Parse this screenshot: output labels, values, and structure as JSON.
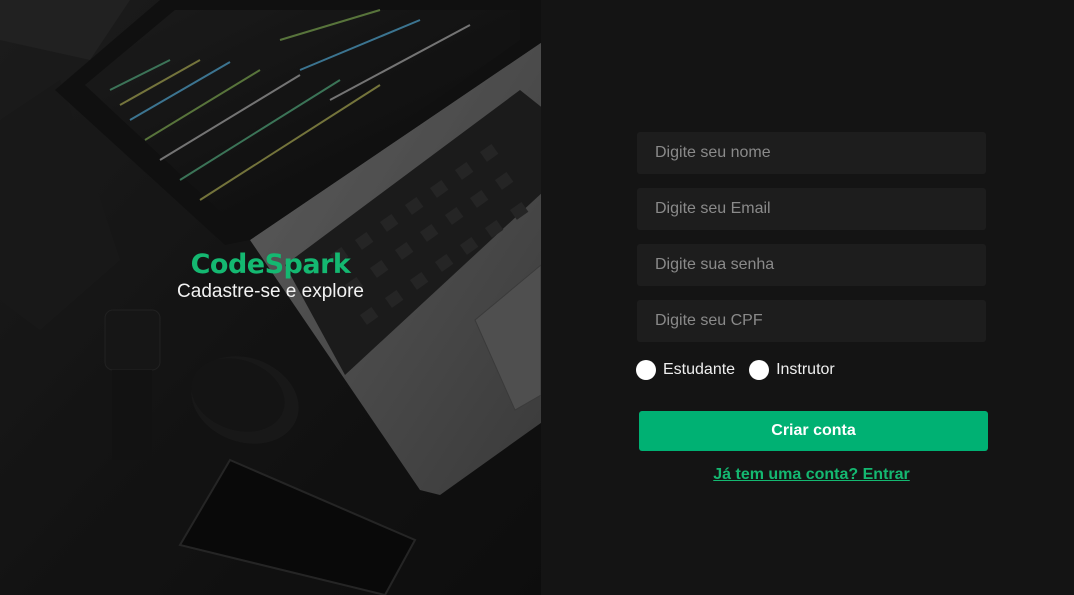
{
  "hero": {
    "logo": "CodeSpark",
    "tagline": "Cadastre-se e explore",
    "background_image": "laptop-keyboard-photo"
  },
  "form": {
    "name_placeholder": "Digite seu nome",
    "email_placeholder": "Digite seu Email",
    "password_placeholder": "Digite sua senha",
    "cpf_placeholder": "Digite seu CPF",
    "roles": [
      {
        "label": "Estudante",
        "selected": false
      },
      {
        "label": "Instrutor",
        "selected": false
      }
    ],
    "submit_label": "Criar conta",
    "login_link": "Já tem uma conta? Entrar"
  },
  "colors": {
    "accent": "#00b173",
    "logo": "#14b871",
    "panel_bg": "#141414",
    "field_bg": "#1d1d1d"
  }
}
